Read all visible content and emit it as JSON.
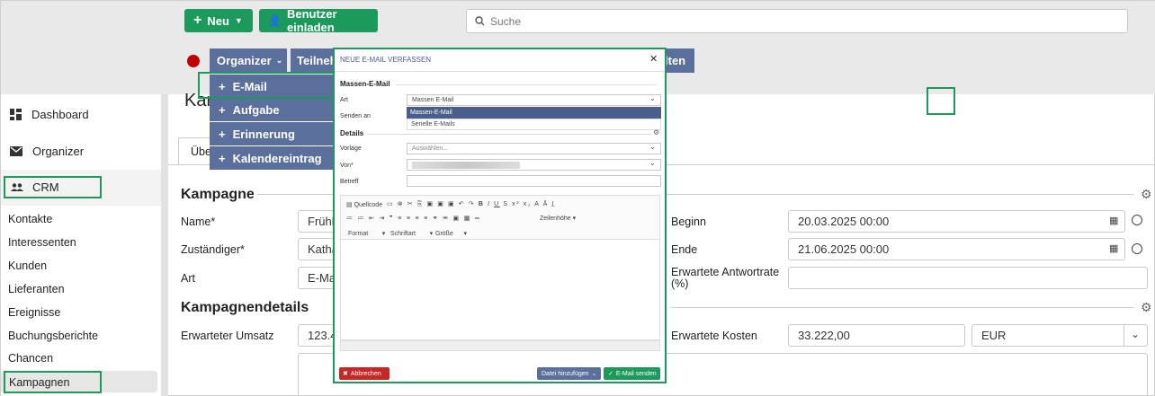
{
  "topbar": {
    "new_label": "Neu",
    "invite_label": "Benutzer einladen",
    "search_placeholder": "Suche"
  },
  "subnav": {
    "organizer_label": "Organizer",
    "participants_label": "Teilneh",
    "right_label": "lten"
  },
  "dropdown": {
    "items": [
      "E-Mail",
      "Aufgabe",
      "Erinnerung",
      "Kalendereintrag"
    ]
  },
  "sidebar": {
    "main": [
      {
        "label": "Dashboard",
        "icon": "dashboard-icon"
      },
      {
        "label": "Organizer",
        "icon": "mail-icon"
      },
      {
        "label": "CRM",
        "icon": "people-icon"
      }
    ],
    "sub": [
      "Kontakte",
      "Interessenten",
      "Kunden",
      "Lieferanten",
      "Ereignisse",
      "Buchungsberichte",
      "Chancen",
      "Kampagnen"
    ]
  },
  "page": {
    "title_fragment": "Kam",
    "tab_fragment": "Übe"
  },
  "campaign": {
    "section_title": "Kampagne",
    "name_label": "Name*",
    "name_value": "Frühl",
    "owner_label": "Zuständiger*",
    "owner_value": "Katha",
    "type_label": "Art",
    "type_value": "E-Ma",
    "start_label": "Beginn",
    "start_value": "20.03.2025 00:00",
    "end_label": "Ende",
    "end_value": "21.06.2025 00:00",
    "response_label": "Erwartete Antwortrate (%)",
    "response_value": ""
  },
  "details": {
    "section_title": "Kampagnendetails",
    "revenue_label": "Erwarteter Umsatz",
    "revenue_value": "123.4",
    "cost_label": "Erwartete Kosten",
    "cost_value": "33.222,00",
    "currency_value": "EUR"
  },
  "modal": {
    "title": "NEUE E-MAIL VERFASSEN",
    "section_mass": "Massen-E-Mail",
    "art_label": "Art",
    "art_value": "Massen E-Mail",
    "send_label": "Senden an",
    "options": [
      "Massen-E-Mail",
      "Serielle E-Mails"
    ],
    "details_title": "Details",
    "template_label": "Vorlage",
    "template_placeholder": "Auswählen...",
    "from_label": "Von*",
    "subject_label": "Betreff",
    "toolbar": {
      "source": "Quellcode",
      "line_height": "Zeilenhöhe",
      "format": "Format",
      "font": "Schriftart",
      "size": "Größe"
    },
    "cancel_label": "Abbrechen",
    "attach_label": "Datei hinzufügen",
    "send_button_label": "E-Mail senden"
  },
  "colors": {
    "accent_green": "#1b9a5c",
    "nav_blue": "#5a6f9b",
    "record_red": "#c00000",
    "cancel_red": "#c62828",
    "highlight_border": "#1b9a5c"
  }
}
